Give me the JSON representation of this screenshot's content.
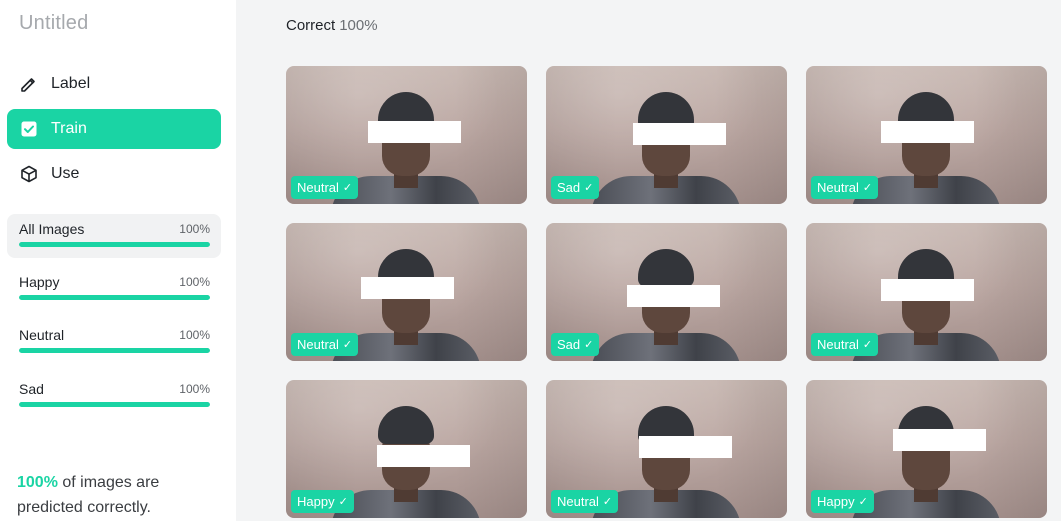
{
  "project": {
    "title": "Untitled"
  },
  "nav": {
    "items": [
      {
        "label": "Label",
        "icon": "pencil-icon",
        "active": false
      },
      {
        "label": "Train",
        "icon": "checkbox-icon",
        "active": true
      },
      {
        "label": "Use",
        "icon": "cube-icon",
        "active": false
      }
    ]
  },
  "classes": [
    {
      "name": "All Images",
      "percent": "100%",
      "progress": 1.0,
      "selected": true
    },
    {
      "name": "Happy",
      "percent": "100%",
      "progress": 1.0,
      "selected": false
    },
    {
      "name": "Neutral",
      "percent": "100%",
      "progress": 1.0,
      "selected": false
    },
    {
      "name": "Sad",
      "percent": "100%",
      "progress": 1.0,
      "selected": false
    }
  ],
  "summary": {
    "percent": "100%",
    "text": " of images are predicted correctly."
  },
  "header": {
    "label": "Correct",
    "value": "100%"
  },
  "images": [
    {
      "label": "Neutral",
      "correct": true
    },
    {
      "label": "Sad",
      "correct": true
    },
    {
      "label": "Neutral",
      "correct": true
    },
    {
      "label": "Neutral",
      "correct": true
    },
    {
      "label": "Sad",
      "correct": true
    },
    {
      "label": "Neutral",
      "correct": true
    },
    {
      "label": "Happy",
      "correct": true
    },
    {
      "label": "Neutral",
      "correct": true
    },
    {
      "label": "Happy",
      "correct": true
    }
  ],
  "colors": {
    "accent": "#1ad4a4",
    "sidebar_bg": "#ffffff",
    "main_bg": "#f3f4f5",
    "title_gray": "#a6a9ad"
  },
  "icons": {
    "check": "✓"
  }
}
